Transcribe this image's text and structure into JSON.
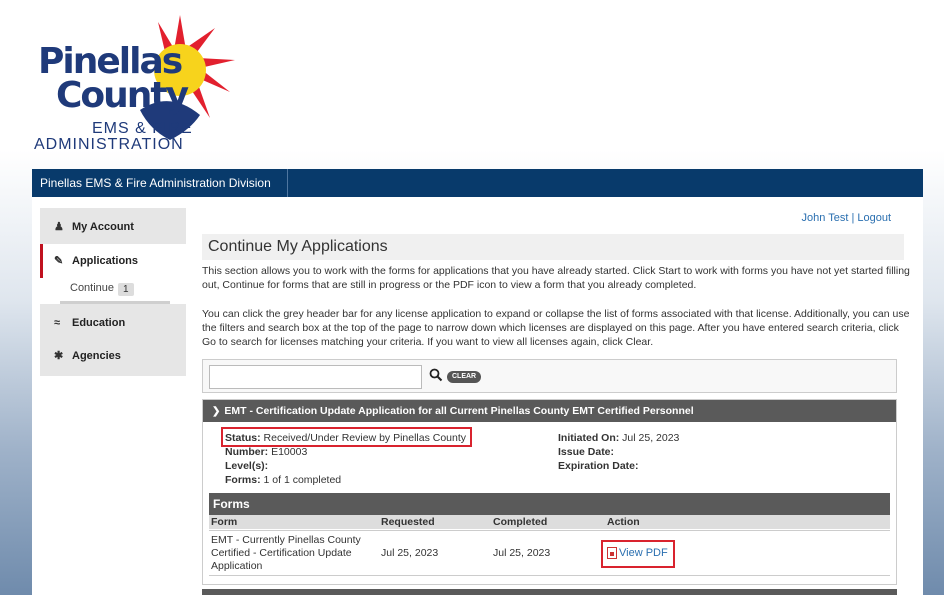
{
  "logo": {
    "line1": "Pinellas",
    "line2": "County",
    "sub1": "EMS & FIRE",
    "sub2": "ADMINISTRATION"
  },
  "topbar": {
    "title": "Pinellas EMS & Fire Administration Division"
  },
  "user": {
    "text": "John Test | Logout"
  },
  "sidebar": {
    "items": [
      {
        "label": "My Account",
        "icon": "person-icon"
      },
      {
        "label": "Applications",
        "icon": "edit-icon"
      },
      {
        "label": "Education",
        "icon": "graduation-cap-icon"
      },
      {
        "label": "Agencies",
        "icon": "asterisk-icon"
      }
    ],
    "sub": {
      "label": "Continue",
      "badge": "1"
    }
  },
  "main": {
    "title": "Continue My Applications",
    "para1": "This section allows you to work with the forms for applications that you have already started. Click Start to work with forms you have not yet started filling out, Continue for forms that are still in progress or the PDF icon to view a form that you already completed.",
    "para2": "You can click the grey header bar for any license application to expand or collapse the list of forms associated with that license. Additionally, you can use the filters and search box at the top of the page to narrow down which licenses are displayed on this page. After you have entered search criteria, click Go to search for licenses matching your criteria. If you want to view all licenses again, click Clear."
  },
  "search": {
    "placeholder": "",
    "value": "",
    "clear_label": "CLEAR"
  },
  "application": {
    "header": "EMT - Certification Update Application for all Current Pinellas County EMT Certified Personnel",
    "status_label": "Status:",
    "status_value": "Received/Under Review by Pinellas County",
    "number_label": "Number:",
    "number_value": "E10003",
    "level_label": "Level(s):",
    "level_value": "",
    "forms_label": "Forms:",
    "forms_value": "1 of 1 completed",
    "initiated_label": "Initiated On:",
    "initiated_value": "Jul 25, 2023",
    "issue_label": "Issue Date:",
    "issue_value": "",
    "expiration_label": "Expiration Date:",
    "expiration_value": ""
  },
  "forms": {
    "title": "Forms",
    "columns": [
      "Form",
      "Requested",
      "Completed",
      "Action"
    ],
    "rows": [
      {
        "form": "EMT - Currently Pinellas County Certified - Certification Update Application",
        "requested": "Jul 25, 2023",
        "completed": "Jul 25, 2023",
        "action": "View PDF"
      }
    ]
  },
  "colors": {
    "topbar": "#083a6b",
    "accent_red": "#d9232e",
    "link": "#2a6fb0",
    "header_grey": "#5a5a5a"
  }
}
